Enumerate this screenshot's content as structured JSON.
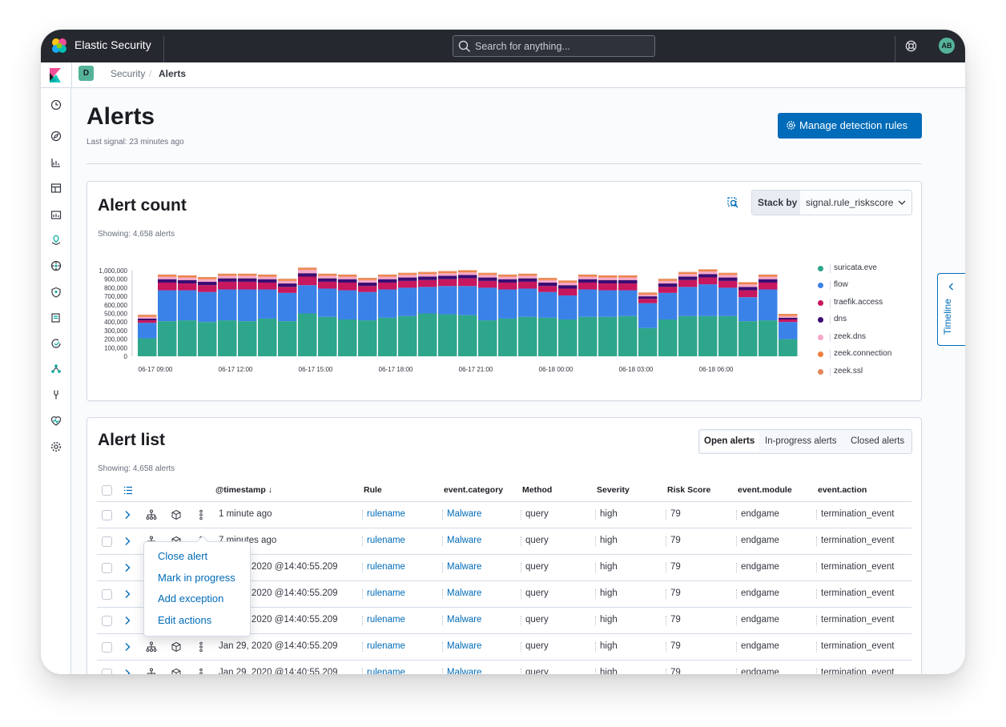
{
  "app": {
    "title": "Elastic Security",
    "avatar_initials": "AB"
  },
  "search": {
    "placeholder": "Search for anything..."
  },
  "breadcrumbs": {
    "space_badge": "D",
    "items": [
      "Security",
      "Alerts"
    ],
    "separator": "/"
  },
  "sidenav": {
    "icons": [
      "clock-icon",
      "compass-icon",
      "dashboard-icon",
      "canvas-icon",
      "maps-icon",
      "ml-icon",
      "graph-icon",
      "security-icon",
      "uptime-icon",
      "apm-icon",
      "logs-icon",
      "devtools-icon",
      "monitoring-icon",
      "management-icon"
    ]
  },
  "page": {
    "title": "Alerts",
    "last_signal": "Last signal: 23 minutes ago",
    "manage_button": "Manage detection rules"
  },
  "alert_count": {
    "title": "Alert count",
    "showing": "Showing: 4,658 alerts",
    "stack_by_label": "Stack by",
    "stack_by_value": "signal.rule_riskscore"
  },
  "chart_data": {
    "type": "bar",
    "stacked": true,
    "ylim": [
      0,
      1000000
    ],
    "y_ticks": [
      "1,000,000",
      "900,000",
      "800,000",
      "700,000",
      "600,000",
      "500,000",
      "400,000",
      "300,000",
      "200,000",
      "100,000",
      "0"
    ],
    "x_ticks": [
      "06-17 09:00",
      "06-17 12:00",
      "06-17 15:00",
      "06-17 18:00",
      "06-17 21:00",
      "06-18 00:00",
      "06-18 03:00",
      "06-18 06:00"
    ],
    "legend_position": "right",
    "series": [
      {
        "name": "suricata.eve",
        "color": "#2ea68c",
        "values": [
          210000,
          410000,
          420000,
          400000,
          420000,
          410000,
          440000,
          410000,
          500000,
          460000,
          430000,
          420000,
          450000,
          470000,
          500000,
          490000,
          480000,
          420000,
          440000,
          460000,
          450000,
          430000,
          460000,
          460000,
          470000,
          330000,
          430000,
          470000,
          470000,
          470000,
          410000,
          420000,
          200000
        ]
      },
      {
        "name": "flow",
        "color": "#3b82e8",
        "values": [
          180000,
          360000,
          350000,
          350000,
          360000,
          370000,
          340000,
          330000,
          330000,
          330000,
          340000,
          330000,
          330000,
          330000,
          310000,
          330000,
          340000,
          380000,
          340000,
          330000,
          300000,
          280000,
          320000,
          310000,
          300000,
          290000,
          310000,
          340000,
          370000,
          330000,
          280000,
          360000,
          200000
        ]
      },
      {
        "name": "traefik.access",
        "color": "#c7175f",
        "values": [
          30000,
          90000,
          80000,
          80000,
          90000,
          90000,
          80000,
          70000,
          100000,
          80000,
          90000,
          70000,
          80000,
          80000,
          80000,
          80000,
          90000,
          80000,
          80000,
          80000,
          70000,
          80000,
          80000,
          80000,
          80000,
          50000,
          70000,
          80000,
          80000,
          80000,
          80000,
          80000,
          30000
        ]
      },
      {
        "name": "dns",
        "color": "#3c0c72",
        "values": [
          20000,
          40000,
          40000,
          40000,
          40000,
          40000,
          40000,
          40000,
          40000,
          40000,
          40000,
          40000,
          40000,
          40000,
          40000,
          40000,
          40000,
          40000,
          40000,
          40000,
          40000,
          40000,
          40000,
          40000,
          40000,
          30000,
          40000,
          40000,
          40000,
          40000,
          40000,
          40000,
          20000
        ]
      },
      {
        "name": "zeek.dns",
        "color": "#f5a7c7",
        "values": [
          20000,
          30000,
          30000,
          30000,
          30000,
          30000,
          30000,
          30000,
          40000,
          30000,
          30000,
          30000,
          30000,
          30000,
          30000,
          30000,
          30000,
          30000,
          30000,
          30000,
          30000,
          30000,
          30000,
          30000,
          30000,
          20000,
          30000,
          30000,
          30000,
          30000,
          30000,
          30000,
          20000
        ]
      },
      {
        "name": "zeek.connection",
        "color": "#f08040",
        "values": [
          15000,
          15000,
          15000,
          15000,
          15000,
          15000,
          15000,
          15000,
          15000,
          15000,
          15000,
          15000,
          15000,
          15000,
          15000,
          15000,
          15000,
          15000,
          15000,
          15000,
          15000,
          15000,
          15000,
          15000,
          15000,
          15000,
          15000,
          15000,
          15000,
          15000,
          15000,
          15000,
          15000
        ]
      },
      {
        "name": "zeek.ssl",
        "color": "#e3875a",
        "values": [
          10000,
          10000,
          10000,
          10000,
          10000,
          10000,
          10000,
          10000,
          10000,
          10000,
          10000,
          10000,
          10000,
          10000,
          10000,
          10000,
          10000,
          10000,
          10000,
          10000,
          10000,
          10000,
          10000,
          10000,
          10000,
          10000,
          10000,
          10000,
          10000,
          10000,
          10000,
          10000,
          10000
        ]
      }
    ]
  },
  "alert_list": {
    "title": "Alert list",
    "showing": "Showing: 4,658 alerts",
    "tabs": [
      "Open alerts",
      "In-progress alerts",
      "Closed alerts"
    ],
    "columns": [
      "@timestamp",
      "Rule",
      "event.category",
      "Method",
      "Severity",
      "Risk Score",
      "event.module",
      "event.action"
    ],
    "rows": [
      {
        "timestamp": "1 minute ago",
        "rule": "rulename",
        "category": "Malware",
        "method": "query",
        "severity": "high",
        "risk": "79",
        "module": "endgame",
        "action": "termination_event"
      },
      {
        "timestamp": "7 minutes ago",
        "rule": "rulename",
        "category": "Malware",
        "method": "query",
        "severity": "high",
        "risk": "79",
        "module": "endgame",
        "action": "termination_event"
      },
      {
        "timestamp": "Jan 29, 2020 @14:40:55.209",
        "rule": "rulename",
        "category": "Malware",
        "method": "query",
        "severity": "high",
        "risk": "79",
        "module": "endgame",
        "action": "termination_event"
      },
      {
        "timestamp": "Jan 29, 2020 @14:40:55.209",
        "rule": "rulename",
        "category": "Malware",
        "method": "query",
        "severity": "high",
        "risk": "79",
        "module": "endgame",
        "action": "termination_event"
      },
      {
        "timestamp": "Jan 29, 2020 @14:40:55.209",
        "rule": "rulename",
        "category": "Malware",
        "method": "query",
        "severity": "high",
        "risk": "79",
        "module": "endgame",
        "action": "termination_event"
      },
      {
        "timestamp": "Jan 29, 2020 @14:40:55.209",
        "rule": "rulename",
        "category": "Malware",
        "method": "query",
        "severity": "high",
        "risk": "79",
        "module": "endgame",
        "action": "termination_event"
      },
      {
        "timestamp": "Jan 29, 2020 @14:40:55.209",
        "rule": "rulename",
        "category": "Malware",
        "method": "query",
        "severity": "high",
        "risk": "79",
        "module": "endgame",
        "action": "termination_event"
      }
    ]
  },
  "row_actions_menu": {
    "items": [
      "Close alert",
      "Mark in progress",
      "Add exception",
      "Edit actions"
    ]
  },
  "timeline": {
    "label": "Timeline"
  },
  "colors": {
    "accent": "#006bb8",
    "topbar": "#25282f",
    "badge": "#54b399"
  }
}
